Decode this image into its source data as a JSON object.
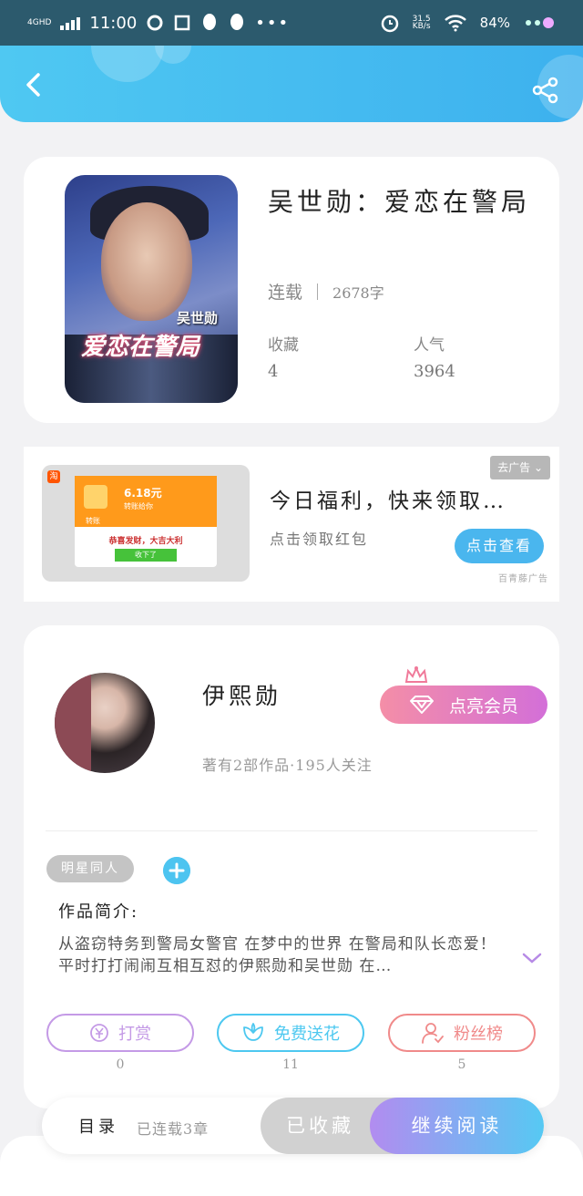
{
  "status_bar": {
    "network": "4GHD",
    "time": "11:00",
    "more": "•••",
    "speed_value": "31.5",
    "speed_unit": "KB/s",
    "battery": "84%"
  },
  "book": {
    "title": "吴世勋：爱恋在警局",
    "cover_author": "吴世勋",
    "cover_title": "爱恋在警局",
    "status": "连载",
    "word_count": "2678字",
    "favorites_label": "收藏",
    "favorites_value": "4",
    "popularity_label": "人气",
    "popularity_value": "3964"
  },
  "ad": {
    "title": "今日福利，快来领取…",
    "subtitle": "点击领取红包",
    "close_label": "去广告",
    "button_label": "点击查看",
    "source": "百青藤广告",
    "thumb": {
      "tb_badge": "淘",
      "amount": "6.18元",
      "sub": "转账给你",
      "tag": "转账",
      "message": "恭喜发财，大吉大利",
      "button": "收下了"
    }
  },
  "author": {
    "name": "伊熙勋",
    "meta": "著有2部作品·195人关注",
    "vip_button": "点亮会员",
    "tag": "明星同人",
    "intro_heading": "作品简介:",
    "intro_text": "从盗窃特务到警局女警官 在梦中的世界 在警局和队长恋爱！平时打打闹闹互相互怼的伊熙勋和吴世勋 在…"
  },
  "actions": [
    {
      "label": "打赏",
      "count": "0",
      "color": "#c49ae6"
    },
    {
      "label": "免费送花",
      "count": "11",
      "color": "#4dc8f0"
    },
    {
      "label": "粉丝榜",
      "count": "5",
      "color": "#f08a8a"
    }
  ],
  "bottom_bar": {
    "toc_label": "目录",
    "toc_count": "已连载3章",
    "collected_label": "已收藏",
    "read_label": "继续阅读"
  }
}
